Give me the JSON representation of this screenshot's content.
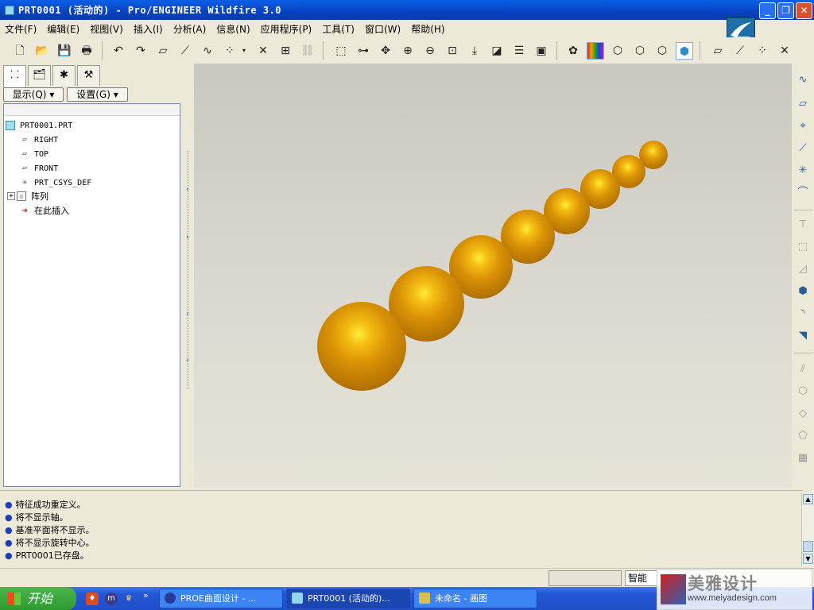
{
  "window": {
    "title": "PRT0001 (活动的) - Pro/ENGINEER Wildfire 3.0",
    "controls": [
      "minimize",
      "maximize",
      "close"
    ]
  },
  "menubar": {
    "items": [
      "文件(F)",
      "编辑(E)",
      "视图(V)",
      "插入(I)",
      "分析(A)",
      "信息(N)",
      "应用程序(P)",
      "工具(T)",
      "窗口(W)",
      "帮助(H)"
    ]
  },
  "toolbar": {
    "icons": [
      "new-file-icon",
      "open-folder-icon",
      "save-icon",
      "print-icon",
      "undo-icon",
      "redo-icon",
      "datum-plane-icon",
      "datum-axis-icon",
      "sketch-curve-icon",
      "datum-point-icon",
      "dropdown-arrow-icon",
      "coordinate-system-icon",
      "annotation-icon",
      "link-icon",
      "redraw-icon",
      "spin-center-icon",
      "orient-mode-icon",
      "zoom-in-icon",
      "zoom-out-icon",
      "refit-icon",
      "reorient-icon",
      "saved-views-icon",
      "layers-icon",
      "view-manager-icon",
      "color-appearance-icon",
      "color-bar-icon",
      "wireframe-icon",
      "hidden-line-icon",
      "no-hidden-icon",
      "shading-icon",
      "plane-display-icon",
      "axis-display-icon",
      "point-display-icon",
      "csys-display-icon"
    ]
  },
  "navigator": {
    "tabs": [
      "model-tree-tab",
      "folder-browser-tab",
      "favorites-tab",
      "connections-tab"
    ],
    "show_button": "显示(Q)",
    "settings_button": "设置(G)",
    "tree": [
      {
        "label": "PRT0001.PRT",
        "icon": "part-icon"
      },
      {
        "label": "RIGHT",
        "icon": "datum-plane-icon"
      },
      {
        "label": "TOP",
        "icon": "datum-plane-icon"
      },
      {
        "label": "FRONT",
        "icon": "datum-plane-icon"
      },
      {
        "label": "PRT_CSYS_DEF",
        "icon": "csys-icon"
      },
      {
        "label": "阵列",
        "icon": "pattern-icon"
      },
      {
        "label": "在此插入",
        "icon": "insert-here-arrow-icon"
      }
    ]
  },
  "viewport": {
    "model": "pattern of 8 gold spheres decreasing in size along a diagonal",
    "sphere_color": "#d99206"
  },
  "right_toolbar": {
    "icons": [
      "sketched-datum-curve-icon",
      "datum-plane-tool-icon",
      "datum-axis-tool-icon",
      "datum-point-tool-icon",
      "datum-csys-tool-icon",
      "sketch-tool-icon",
      "extrude-icon",
      "revolve-icon",
      "sweep-icon",
      "blend-icon",
      "round-icon",
      "chamfer-icon",
      "hole-icon",
      "shell-icon",
      "rib-icon",
      "draft-icon",
      "mirror-icon",
      "merge-icon",
      "trim-icon",
      "pattern-icon"
    ]
  },
  "messages": [
    "特征成功重定义。",
    "将不显示轴。",
    "基准平面将不显示。",
    "将不显示旋转中心。",
    "PRT0001已存盘。"
  ],
  "statusbar": {
    "filter": "智能"
  },
  "taskbar": {
    "start_label": "开始",
    "tasks": [
      "PROE曲面设计 - ...",
      "PRT0001 (活动的)...",
      "未命名 - 画图"
    ]
  },
  "watermark": {
    "title": "美雅设计",
    "url": "www.meiyadesign.com"
  }
}
